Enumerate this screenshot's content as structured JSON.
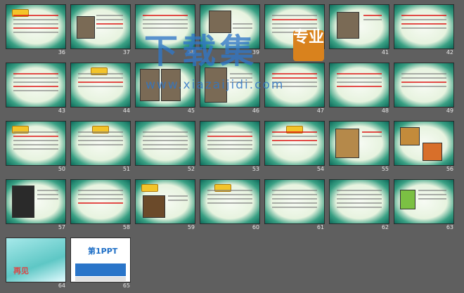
{
  "slide_numbers": [
    "36",
    "37",
    "38",
    "39",
    "40",
    "41",
    "42",
    "43",
    "44",
    "45",
    "46",
    "47",
    "48",
    "49",
    "50",
    "51",
    "52",
    "53",
    "54",
    "55",
    "56",
    "57",
    "58",
    "59",
    "60",
    "61",
    "62",
    "63",
    "64",
    "65"
  ],
  "watermark": {
    "text": "下载集",
    "seal": "专业",
    "url": "www.xiazaijidi.com"
  },
  "last_slide_labels": {
    "scene_title": "再见",
    "ppt_logo": "第1PPT"
  }
}
